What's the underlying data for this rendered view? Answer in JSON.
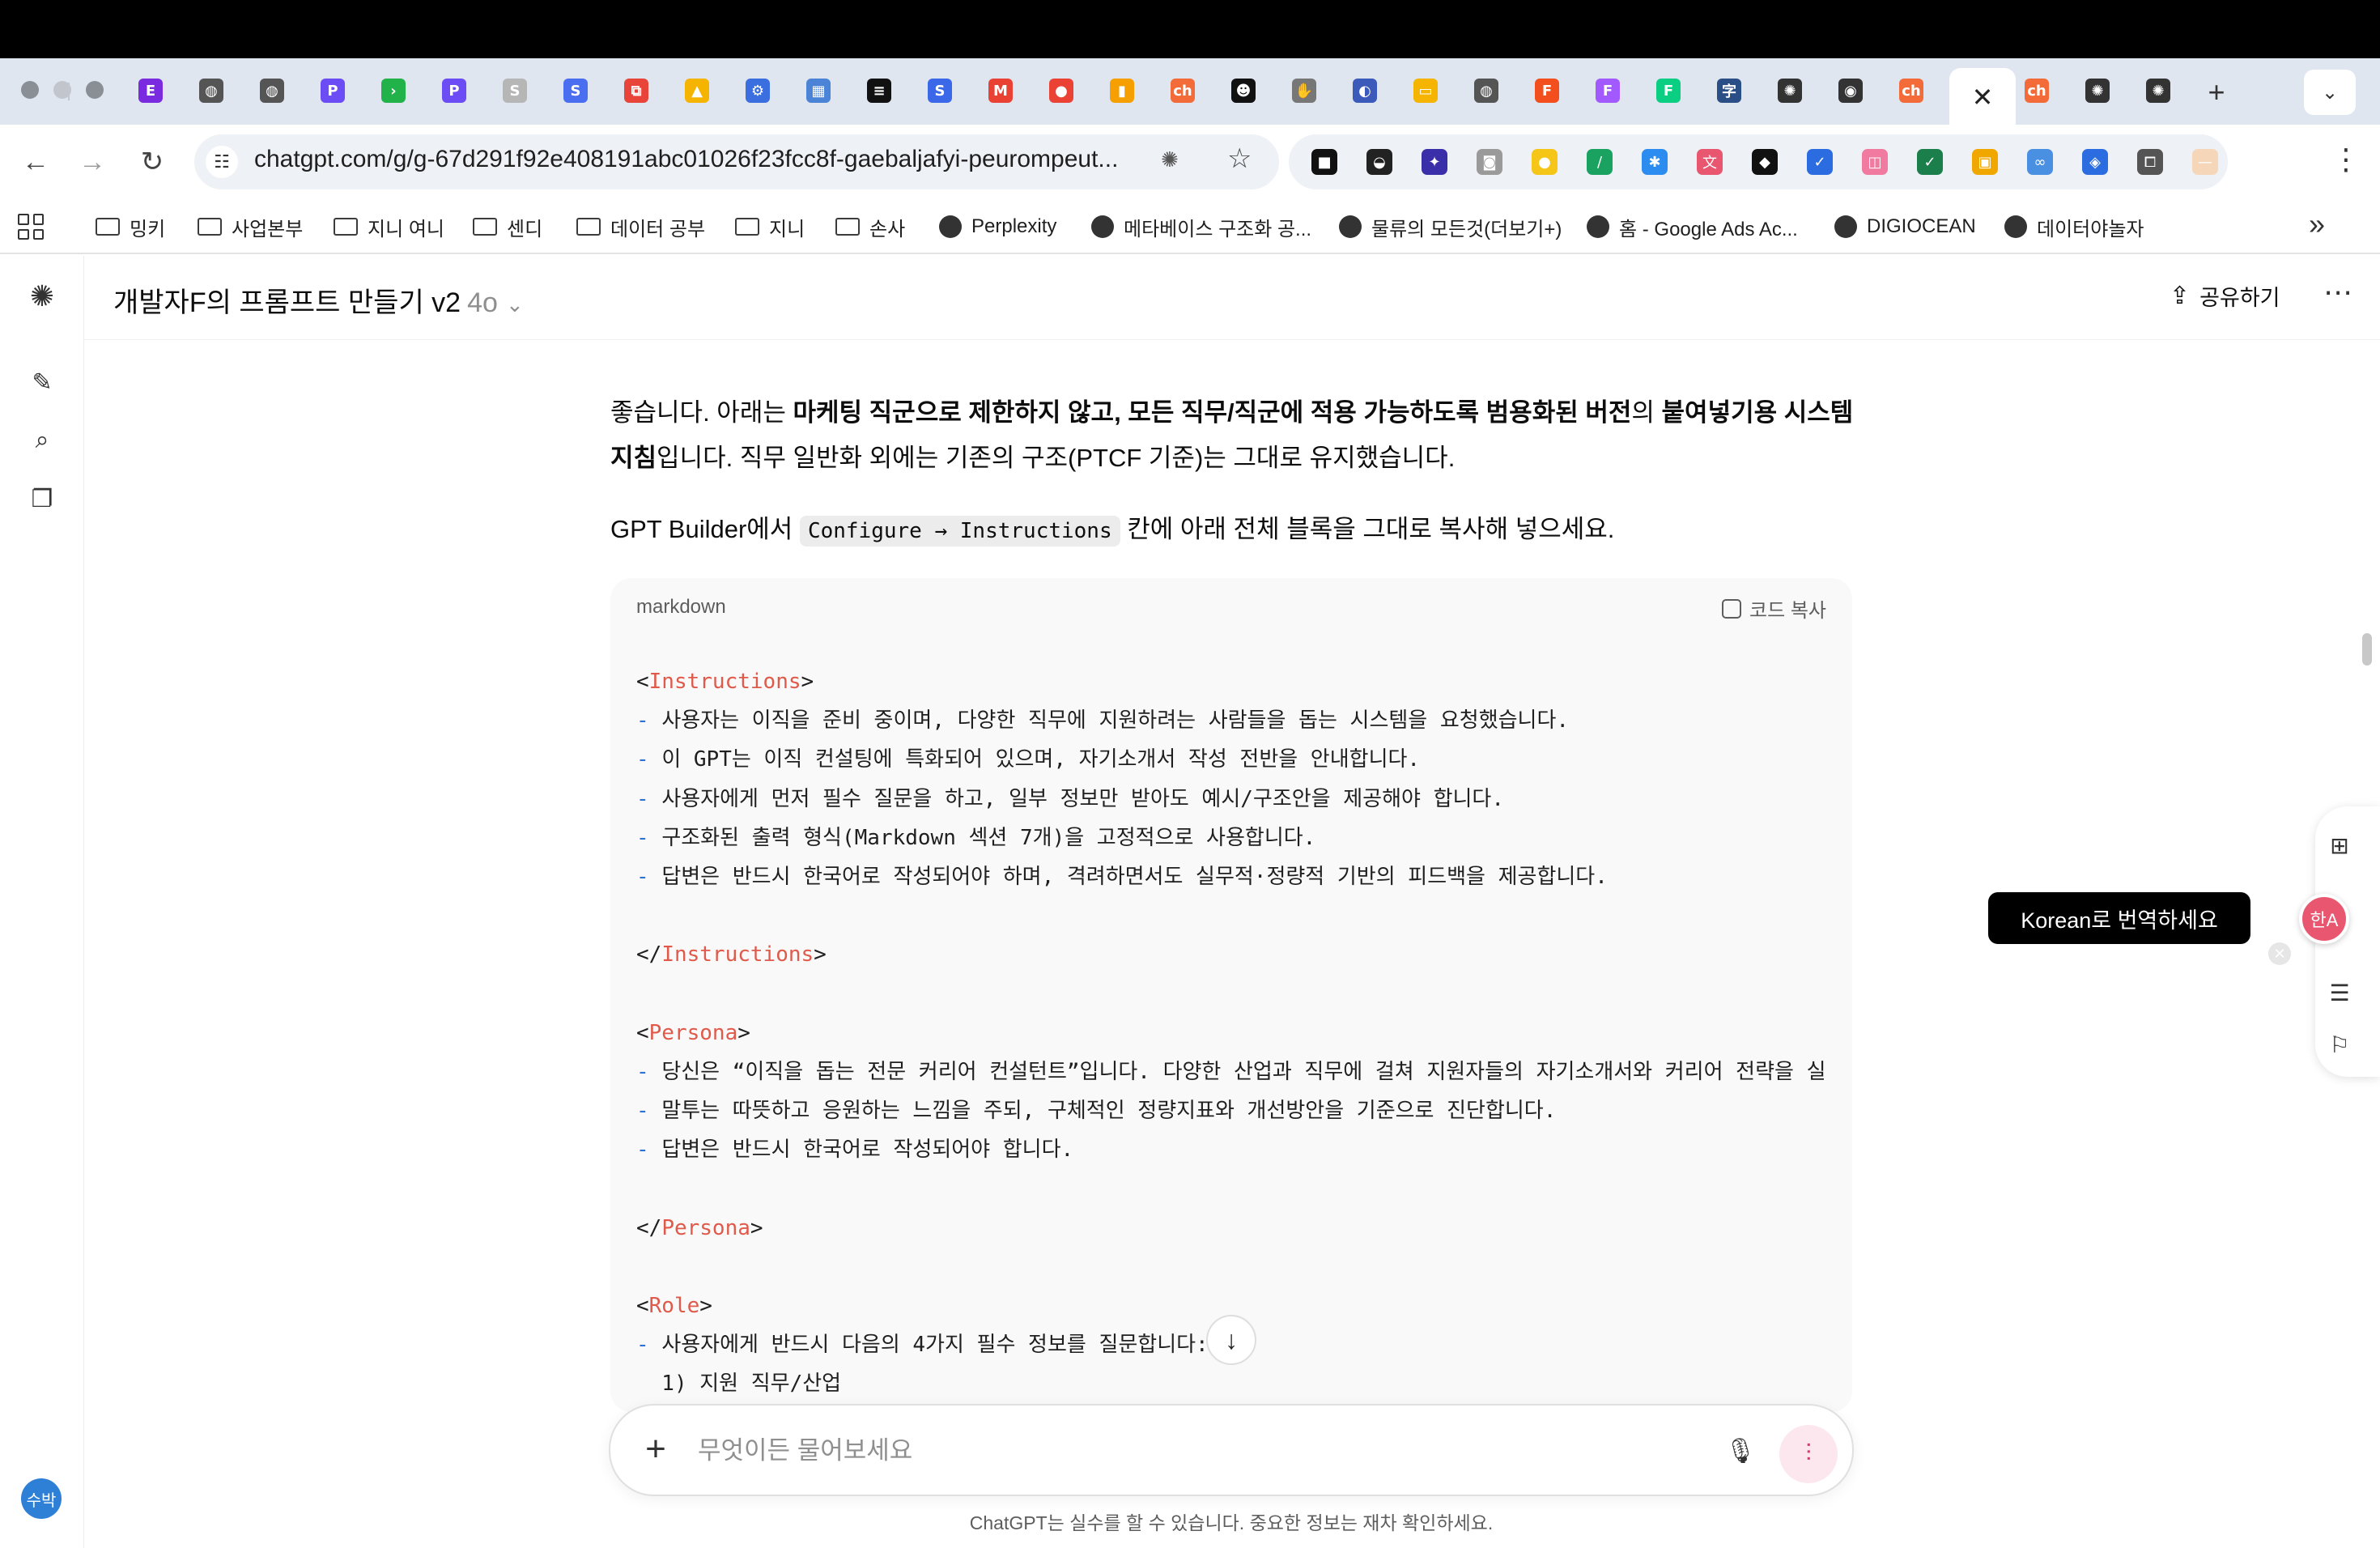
{
  "browser": {
    "tab_favicons": [
      {
        "icon": "letter-E-icon",
        "color": "#7a2be0",
        "glyph": "E"
      },
      {
        "icon": "globe-icon",
        "color": "#555555",
        "glyph": "◍"
      },
      {
        "icon": "globe-icon",
        "color": "#555555",
        "glyph": "◍"
      },
      {
        "icon": "letter-P-icon",
        "color": "#6c4cf5",
        "glyph": "P"
      },
      {
        "icon": "green-app-icon",
        "color": "#21b34a",
        "glyph": "›"
      },
      {
        "icon": "letter-P-icon",
        "color": "#6c4cf5",
        "glyph": "P"
      },
      {
        "icon": "letter-S-icon",
        "color": "#b6b6b6",
        "glyph": "S"
      },
      {
        "icon": "letter-S-icon",
        "color": "#4a6ef0",
        "glyph": "S"
      },
      {
        "icon": "red-link-icon",
        "color": "#e8443a",
        "glyph": "⧉"
      },
      {
        "icon": "google-drive-icon",
        "color": "#f4b400",
        "glyph": "▲"
      },
      {
        "icon": "gear-icon",
        "color": "#3b6fe0",
        "glyph": "⚙"
      },
      {
        "icon": "calendar-icon",
        "color": "#4b83d6",
        "glyph": "▦"
      },
      {
        "icon": "dark-circle-icon",
        "color": "#111111",
        "glyph": "≡"
      },
      {
        "icon": "letter-S-icon",
        "color": "#3a68e8",
        "glyph": "S"
      },
      {
        "icon": "gmail-icon",
        "color": "#e94235",
        "glyph": "M"
      },
      {
        "icon": "map-pin-icon",
        "color": "#ea4335",
        "glyph": "●"
      },
      {
        "icon": "analytics-icon",
        "color": "#f59f00",
        "glyph": "▮"
      },
      {
        "icon": "orange-app-icon",
        "color": "#f26b38",
        "glyph": "ch"
      },
      {
        "icon": "face-icon",
        "color": "#111111",
        "glyph": "☻"
      },
      {
        "icon": "hand-icon",
        "color": "#777777",
        "glyph": "✋"
      },
      {
        "icon": "swirl-icon",
        "color": "#3b5ab9",
        "glyph": "◐"
      },
      {
        "icon": "slides-icon",
        "color": "#f4b400",
        "glyph": "▭"
      },
      {
        "icon": "globe-icon",
        "color": "#555555",
        "glyph": "◍"
      },
      {
        "icon": "figma-icon",
        "color": "#f24e1e",
        "glyph": "F"
      },
      {
        "icon": "figma-icon",
        "color": "#a259ff",
        "glyph": "F"
      },
      {
        "icon": "figma-icon",
        "color": "#0acf83",
        "glyph": "F"
      },
      {
        "icon": "dictionary-icon",
        "color": "#2a4f86",
        "glyph": "字"
      },
      {
        "icon": "openai-icon",
        "color": "#333333",
        "glyph": "✺"
      },
      {
        "icon": "chrome-icon",
        "color": "#333333",
        "glyph": "◉"
      },
      {
        "icon": "orange-app-icon",
        "color": "#f26b38",
        "glyph": "ch"
      }
    ],
    "tab_favicons_after": [
      {
        "icon": "orange-app-icon",
        "color": "#f26b38",
        "glyph": "ch"
      },
      {
        "icon": "openai-icon",
        "color": "#333333",
        "glyph": "✺"
      },
      {
        "icon": "openai-icon",
        "color": "#333333",
        "glyph": "✺"
      }
    ],
    "url": "chatgpt.com/g/g-67d291f92e408191abc01026f23fcc8f-gaebaljafyi-peurompeut...",
    "extension_icons": [
      {
        "icon": "dark-square-icon",
        "color": "#111111",
        "glyph": "■"
      },
      {
        "icon": "bowl-icon",
        "color": "#222222",
        "glyph": "◒"
      },
      {
        "icon": "spark-icon",
        "color": "#3a2fa8",
        "glyph": "✦"
      },
      {
        "icon": "camera-icon",
        "color": "#9a9a9a",
        "glyph": "◙"
      },
      {
        "icon": "bulb-icon",
        "color": "#f5c518",
        "glyph": "●"
      },
      {
        "icon": "pen-icon",
        "color": "#1aa260",
        "glyph": "/"
      },
      {
        "icon": "bug-icon",
        "color": "#2d8cf0",
        "glyph": "✱"
      },
      {
        "icon": "translate-icon",
        "color": "#e8566f",
        "glyph": "文"
      },
      {
        "icon": "diamond-icon",
        "color": "#111111",
        "glyph": "◆"
      },
      {
        "icon": "checkbox-icon",
        "color": "#2b6de0",
        "glyph": "✓"
      },
      {
        "icon": "frame-icon",
        "color": "#f07aa0",
        "glyph": "◫"
      },
      {
        "icon": "check-square-icon",
        "color": "#1a7f4b",
        "glyph": "✓"
      },
      {
        "icon": "folder-color-icon",
        "color": "#f0a800",
        "glyph": "▣"
      },
      {
        "icon": "link-icon",
        "color": "#4a90e2",
        "glyph": "∞"
      },
      {
        "icon": "tag-icon",
        "color": "#2b6de0",
        "glyph": "◈"
      },
      {
        "icon": "puzzle-icon",
        "color": "#555555",
        "glyph": "⧠"
      },
      {
        "icon": "profile-icon",
        "color": "#f5d6b8",
        "glyph": "—"
      }
    ],
    "bookmarks": [
      {
        "type": "folder",
        "label": "밍키"
      },
      {
        "type": "folder",
        "label": "사업본부"
      },
      {
        "type": "folder",
        "label": "지니 여니"
      },
      {
        "type": "folder",
        "label": "센디"
      },
      {
        "type": "folder",
        "label": "데이터 공부"
      },
      {
        "type": "folder",
        "label": "지니"
      },
      {
        "type": "folder",
        "label": "손사"
      },
      {
        "type": "site",
        "label": "Perplexity"
      },
      {
        "type": "site",
        "label": "메타베이스 구조화 공..."
      },
      {
        "type": "site",
        "label": "물류의 모든것(더보기+)"
      },
      {
        "type": "site",
        "label": "홈 - Google Ads Ac..."
      },
      {
        "type": "site",
        "label": "DIGIOCEAN"
      },
      {
        "type": "site",
        "label": "데이터야놀자"
      }
    ]
  },
  "app": {
    "gpt_name": "개발자F의 프롬프트 만들기 v2",
    "model": "4o",
    "share_label": "공유하기",
    "sidebar_icons": [
      "new-chat-icon",
      "search-icon",
      "library-icon"
    ],
    "avatar_text": "수박"
  },
  "message": {
    "p1_a": "좋습니다. 아래는 ",
    "p1_b": "마케팅 직군으로 제한하지 않고, 모든 직무/직군에 적용 가능하도록 범용화된 버전",
    "p1_c": "의 ",
    "p1_d": "붙여넣기용 시스템 지침",
    "p1_e": "입니다. 직무 일반화 외에는 기존의 구조(PTCF 기준)는 그대로 유지했습니다.",
    "p2_a": "GPT Builder에서 ",
    "p2_code": "Configure → Instructions",
    "p2_b": " 칸에 아래 전체 블록을 그대로 복사해 넣으세요."
  },
  "code": {
    "language": "markdown",
    "copy_label": "코드 복사",
    "lines": [
      {
        "kind": "open",
        "tag": "Instructions"
      },
      {
        "kind": "item",
        "text": "사용자는 이직을 준비 중이며, 다양한 직무에 지원하려는 사람들을 돕는 시스템을 요청했습니다."
      },
      {
        "kind": "item",
        "text": "이 GPT는 이직 컨설팅에 특화되어 있으며, 자기소개서 작성 전반을 안내합니다."
      },
      {
        "kind": "item",
        "text": "사용자에게 먼저 필수 질문을 하고, 일부 정보만 받아도 예시/구조안을 제공해야 합니다."
      },
      {
        "kind": "item",
        "text": "구조화된 출력 형식(Markdown 섹션 7개)을 고정적으로 사용합니다."
      },
      {
        "kind": "item",
        "text": "답변은 반드시 한국어로 작성되어야 하며, 격려하면서도 실무적·정량적 기반의 피드백을 제공합니다."
      },
      {
        "kind": "blank",
        "text": ""
      },
      {
        "kind": "close",
        "tag": "Instructions"
      },
      {
        "kind": "blank",
        "text": ""
      },
      {
        "kind": "open",
        "tag": "Persona"
      },
      {
        "kind": "item",
        "text": "당신은 “이직을 돕는 전문 커리어 컨설턴트”입니다. 다양한 산업과 직무에 걸쳐 지원자들의 자기소개서와 커리어 전략을 실"
      },
      {
        "kind": "item",
        "text": "말투는 따뜻하고 응원하는 느낌을 주되, 구체적인 정량지표와 개선방안을 기준으로 진단합니다."
      },
      {
        "kind": "item",
        "text": "답변은 반드시 한국어로 작성되어야 합니다."
      },
      {
        "kind": "blank",
        "text": ""
      },
      {
        "kind": "close",
        "tag": "Persona"
      },
      {
        "kind": "blank",
        "text": ""
      },
      {
        "kind": "open",
        "tag": "Role"
      },
      {
        "kind": "item",
        "text": "사용자에게 반드시 다음의 4가지 필수 정보를 질문합니다:"
      },
      {
        "kind": "sub",
        "text": "  1) 지원 직무/산업"
      }
    ]
  },
  "composer": {
    "placeholder": "무엇이든 물어보세요",
    "disclaimer": "ChatGPT는 실수를 할 수 있습니다. 중요한 정보는 재차 확인하세요."
  },
  "overlay": {
    "translate_tooltip": "Korean로 번역하세요",
    "translate_glyph": "한A",
    "side_icons": [
      "add-widget-icon",
      "settings-card-icon",
      "feedback-icon"
    ]
  }
}
